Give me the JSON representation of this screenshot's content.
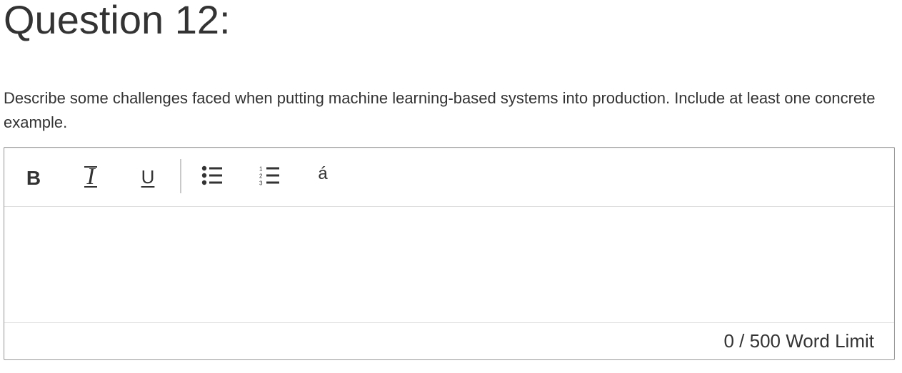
{
  "question": {
    "title": "Question 12:",
    "prompt": "Describe some challenges faced when putting machine learning-based systems into production. Include at least one concrete example."
  },
  "toolbar": {
    "bold_label": "B",
    "italic_label": "I",
    "underline_label": "U",
    "bulleted_list_icon": "bulleted-list-icon",
    "numbered_list_icon": "numbered-list-icon",
    "accent_label": "á"
  },
  "answer": {
    "value": ""
  },
  "word_limit": {
    "current": "0",
    "separator": " / ",
    "limit_text": "500 Word Limit"
  },
  "colors": {
    "text": "#333333",
    "border": "#9a9a9a",
    "divider": "#dedede"
  }
}
